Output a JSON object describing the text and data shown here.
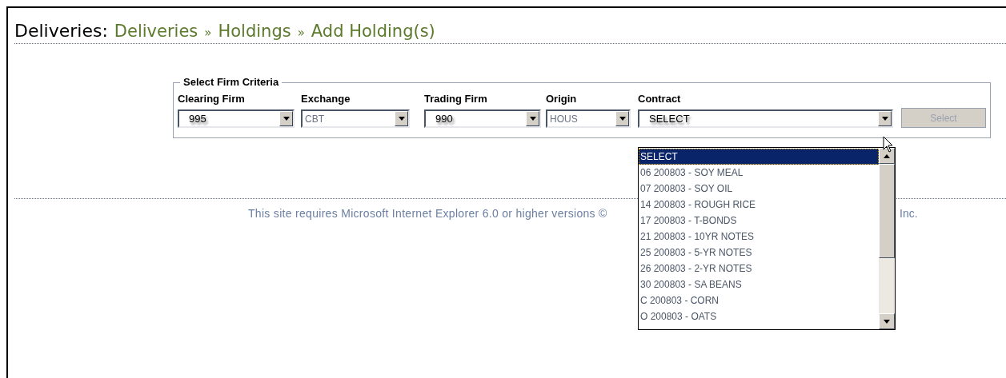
{
  "header": {
    "title": "Deliveries:",
    "breadcrumb": [
      {
        "label": "Deliveries"
      },
      {
        "label": "Holdings"
      },
      {
        "label": "Add Holding(s)"
      }
    ],
    "separator": "»"
  },
  "criteria": {
    "legend": "Select Firm Criteria",
    "fields": [
      {
        "label": "Clearing Firm",
        "value": "995",
        "disabled": false
      },
      {
        "label": "Exchange",
        "value": "CBT",
        "disabled": true
      },
      {
        "label": "Trading Firm",
        "value": "990",
        "disabled": false
      },
      {
        "label": "Origin",
        "value": "HOUS",
        "disabled": true
      },
      {
        "label": "Contract",
        "value": "SELECT",
        "disabled": false
      }
    ],
    "button": {
      "label": "Select",
      "disabled": true
    }
  },
  "contract_dropdown": {
    "options": [
      {
        "label": "SELECT",
        "selected": true
      },
      {
        "label": "06 200803 - SOY MEAL",
        "selected": false
      },
      {
        "label": "07 200803 - SOY OIL",
        "selected": false
      },
      {
        "label": "14 200803 - ROUGH RICE",
        "selected": false
      },
      {
        "label": "17 200803 - T-BONDS",
        "selected": false
      },
      {
        "label": "21 200803 - 10YR NOTES",
        "selected": false
      },
      {
        "label": "25 200803 - 5-YR NOTES",
        "selected": false
      },
      {
        "label": "26 200803 - 2-YR NOTES",
        "selected": false
      },
      {
        "label": "30 200803 - SA BEANS",
        "selected": false
      },
      {
        "label": "C 200803 - CORN",
        "selected": false
      },
      {
        "label": "O 200803 - OATS",
        "selected": false
      }
    ]
  },
  "footer": [
    "This site requires Microsoft Internet Explorer 6.0 or higher versions ©",
    "Inc."
  ]
}
